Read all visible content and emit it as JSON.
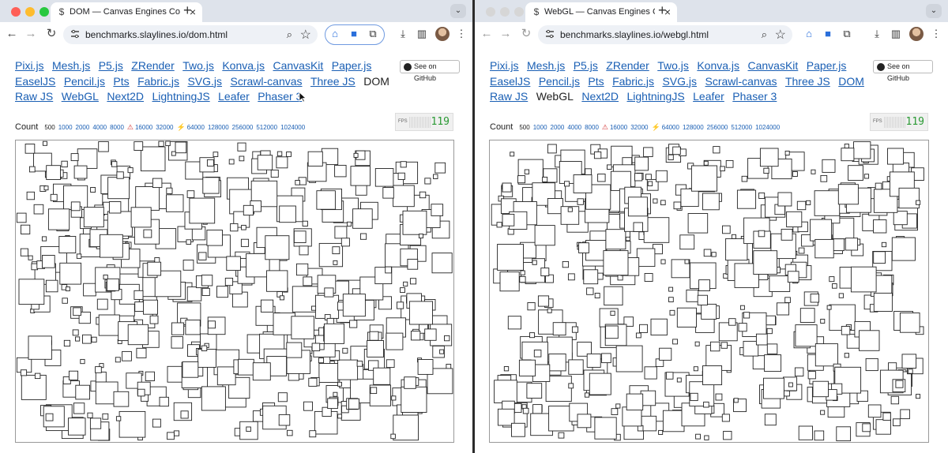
{
  "colors": {
    "link": "#1a5fb4",
    "fps_value": "#2a9a34",
    "warning": "#d32f2f",
    "bolt": "#f2b400",
    "tab_bar": "#dee3eb"
  },
  "left": {
    "tab": {
      "title": "DOM — Canvas Engines Comparison",
      "close": "×",
      "new_tab": "+"
    },
    "address": {
      "url": "benchmarks.slaylines.io/dom.html"
    },
    "current_engine": "DOM",
    "count": {
      "label": "Count",
      "plain": [
        "500"
      ],
      "normal": [
        "1000",
        "2000",
        "4000",
        "8000"
      ],
      "warn": [
        "16000",
        "32000"
      ],
      "fast": [
        "64000",
        "128000",
        "256000",
        "512000",
        "1024000"
      ]
    },
    "github": "See on GitHub",
    "fps": {
      "label": "FPS",
      "value": "119"
    }
  },
  "right": {
    "tab": {
      "title": "WebGL — Canvas Engines Comparison",
      "close": "×",
      "new_tab": "+"
    },
    "address": {
      "url": "benchmarks.slaylines.io/webgl.html"
    },
    "current_engine": "WebGL",
    "count": {
      "label": "Count",
      "plain": [
        "500"
      ],
      "normal": [
        "1000",
        "2000",
        "4000",
        "8000"
      ],
      "warn": [
        "16000",
        "32000"
      ],
      "fast": [
        "64000",
        "128000",
        "256000",
        "512000",
        "1024000"
      ]
    },
    "github": "See on GitHub",
    "fps": {
      "label": "FPS",
      "value": "119"
    }
  },
  "engines": [
    "Pixi.js",
    "Mesh.js",
    "P5.js",
    "ZRender",
    "Two.js",
    "Konva.js",
    "CanvasKit",
    "Paper.js",
    "EaselJS",
    "Pencil.js",
    "Pts",
    "Fabric.js",
    "SVG.js",
    "Scrawl-canvas",
    "Three JS",
    "DOM",
    "Raw JS",
    "WebGL",
    "Next2D",
    "LightningJS",
    "Leafer",
    "Phaser 3"
  ],
  "icons": {
    "back": "arrow-left-icon",
    "forward": "arrow-right-icon",
    "reload": "reload-icon",
    "site": "site-settings-icon",
    "zoom": "magnifier-icon",
    "bookmark": "star-icon",
    "github": "github-icon",
    "warning": "warning-triangle-icon",
    "fast": "lightning-bolt-icon"
  }
}
